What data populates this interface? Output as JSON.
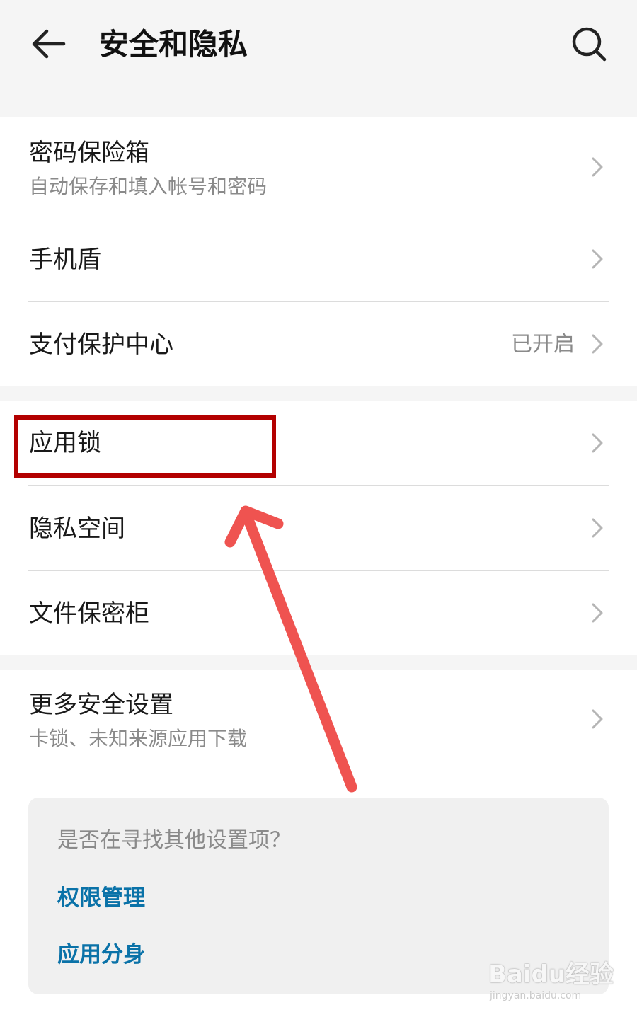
{
  "header": {
    "title": "安全和隐私",
    "back_icon": "arrow-left-icon",
    "search_icon": "search-icon"
  },
  "groups": [
    {
      "items": [
        {
          "title": "密码保险箱",
          "subtitle": "自动保存和填入帐号和密码"
        },
        {
          "title": "手机盾"
        },
        {
          "title": "支付保护中心",
          "value": "已开启"
        }
      ]
    },
    {
      "items": [
        {
          "title": "应用锁"
        },
        {
          "title": "隐私空间"
        },
        {
          "title": "文件保密柜"
        }
      ]
    },
    {
      "items": [
        {
          "title": "更多安全设置",
          "subtitle": "卡锁、未知来源应用下载"
        }
      ]
    }
  ],
  "suggestions": {
    "question": "是否在寻找其他设置项？",
    "links": [
      "权限管理",
      "应用分身"
    ]
  },
  "annotation": {
    "highlight_color": "#b30000",
    "arrow_color": "#ef5350"
  },
  "watermark": {
    "logo": "Baidu经验",
    "url": "jingyan.baidu.com"
  },
  "colors": {
    "link": "#0a72a8",
    "secondary_text": "#8a8a8a",
    "background": "#f5f5f5"
  }
}
